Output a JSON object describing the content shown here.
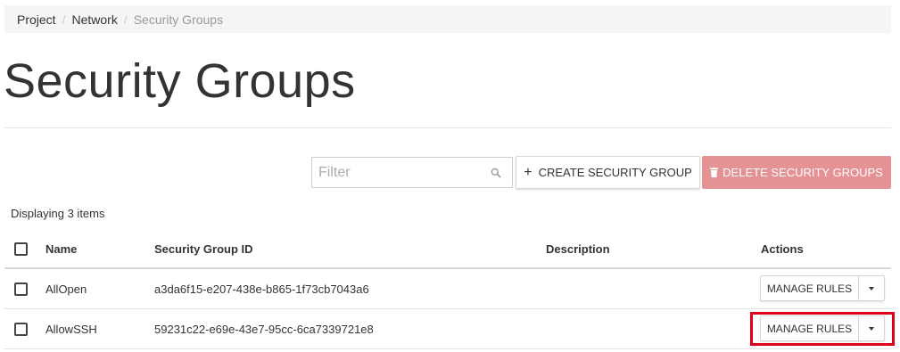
{
  "breadcrumb": {
    "items": [
      "Project",
      "Network"
    ],
    "separator": "/",
    "active": "Security Groups"
  },
  "page": {
    "title": "Security Groups"
  },
  "toolbar": {
    "filter_placeholder": "Filter",
    "create_label": "CREATE SECURITY GROUP",
    "delete_label": "DELETE SECURITY GROUPS"
  },
  "table": {
    "count_text": "Displaying 3 items",
    "columns": [
      "Name",
      "Security Group ID",
      "Description",
      "Actions"
    ],
    "rows": [
      {
        "name": "AllOpen",
        "id": "a3da6f15-e207-438e-b865-1f73cb7043a6",
        "description": "",
        "action": "MANAGE RULES"
      },
      {
        "name": "AllowSSH",
        "id": "59231c22-e69e-43e7-95cc-6ca7339721e8",
        "description": "",
        "action": "MANAGE RULES"
      }
    ]
  },
  "colors": {
    "delete_button": "#e59294",
    "highlight": "#e0001a"
  }
}
